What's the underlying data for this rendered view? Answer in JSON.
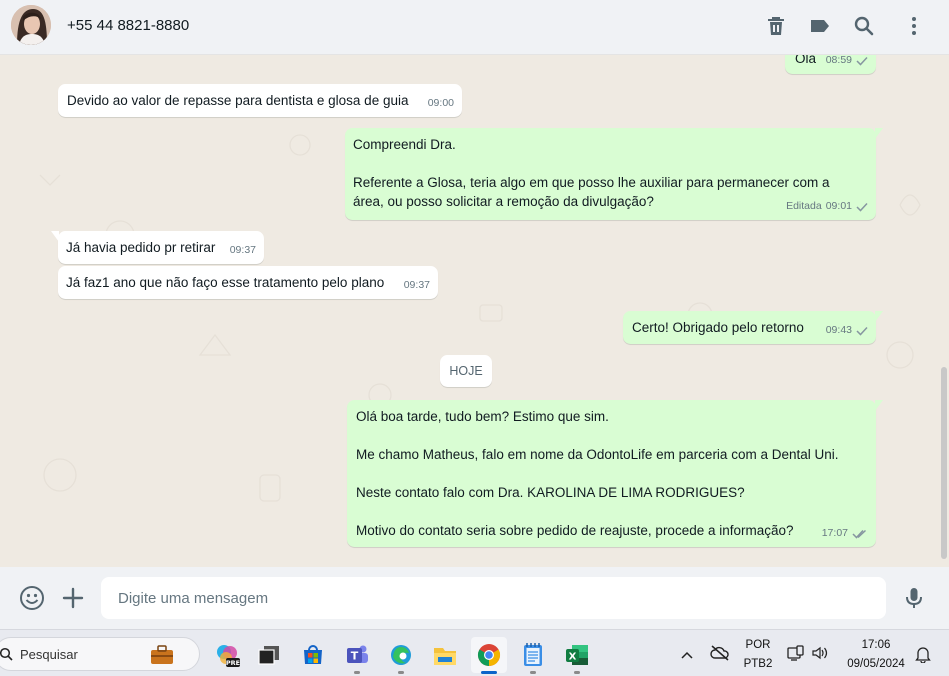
{
  "header": {
    "contact_name": "+55 44 8821-8880",
    "icons": [
      "delete-icon",
      "label-icon",
      "search-icon",
      "menu-icon"
    ]
  },
  "messages": [
    {
      "direction": "out",
      "text": "Olá",
      "time": "08:59",
      "status": "sent"
    },
    {
      "direction": "in",
      "text": "Devido ao valor de repasse para dentista e glosa de guia",
      "time": "09:00"
    },
    {
      "direction": "out",
      "text": "Compreendi Dra.\n\nReferente a Glosa, teria algo em que posso lhe auxiliar para permanecer com a\nárea, ou posso solicitar a remoção da divulgação?",
      "edited_label": "Editada",
      "time": "09:01",
      "status": "sent"
    },
    {
      "direction": "in",
      "text": "Já havia pedido pr retirar",
      "time": "09:37"
    },
    {
      "direction": "in",
      "text": "Já faz1 ano que não faço esse tratamento pelo plano",
      "time": "09:37"
    },
    {
      "direction": "out",
      "text": "Certo! Obrigado pelo retorno",
      "time": "09:43",
      "status": "sent"
    },
    {
      "direction": "out",
      "text": "Olá boa tarde, tudo bem? Estimo que sim.\n\nMe chamo Matheus, falo em nome da OdontoLife em parceria com a Dental Uni.\n\nNeste contato falo com Dra. KAROLINA DE LIMA RODRIGUES?\n\nMotivo do contato seria sobre pedido de reajuste, procede a informação?",
      "time": "17:07",
      "status": "delivered"
    }
  ],
  "day_separator": "HOJE",
  "composer": {
    "placeholder": "Digite uma mensagem",
    "icons": [
      "emoji-icon",
      "attach-plus-icon",
      "microphone-icon"
    ]
  },
  "taskbar": {
    "search_label": "Pesquisar",
    "apps": [
      "work-briefcase",
      "copilot-pre",
      "task-view",
      "microsoft-store",
      "teams",
      "edge",
      "file-explorer",
      "chrome",
      "notepad",
      "excel"
    ],
    "active_app": "chrome",
    "language_line1": "POR",
    "language_line2": "PTB2",
    "time": "17:06",
    "date": "09/05/2024"
  },
  "colors": {
    "incoming_bubble": "#ffffff",
    "outgoing_bubble": "#d9fdd3",
    "chat_background": "#efeae2",
    "delivered_tick": "#8696a0"
  }
}
